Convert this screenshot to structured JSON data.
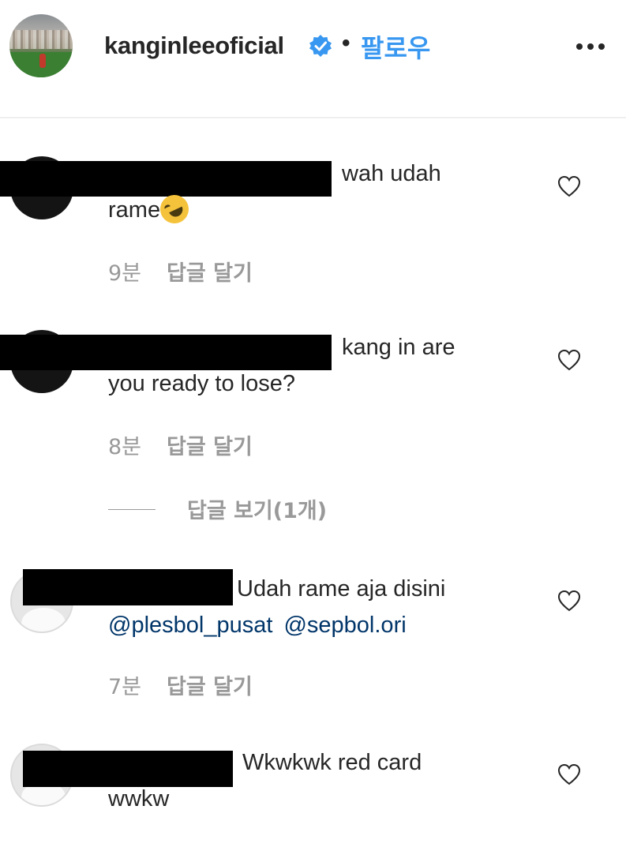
{
  "header": {
    "username": "kanginleeoficial",
    "separator": "•",
    "follow_label": "팔로우",
    "more_icon": "more-horizontal-icon",
    "verified_icon": "verified-badge-icon",
    "colors": {
      "accent": "#3897f0",
      "verified": "#3897f0"
    }
  },
  "comments": [
    {
      "text_line1": "wah udah",
      "text_line2": "rame",
      "emoji": "rolling-on-floor-laughing-emoji",
      "time": "9분",
      "reply_label": "답글 달기"
    },
    {
      "text_line1": "kang in are",
      "text_line2": "you ready to lose?",
      "time": "8분",
      "reply_label": "답글 달기",
      "view_replies_label": "답글 보기(1개)"
    },
    {
      "text_line1": "Udah rame aja disini",
      "mention1": "@plesbol_pusat",
      "mention2": "@sepbol.ori",
      "time": "7분",
      "reply_label": "답글 달기"
    },
    {
      "text_line1": "Wkwkwk red card",
      "text_line2": "wwkw"
    }
  ],
  "colors": {
    "text": "#262626",
    "meta": "#999999",
    "mention": "#003569",
    "redaction": "#000000"
  }
}
